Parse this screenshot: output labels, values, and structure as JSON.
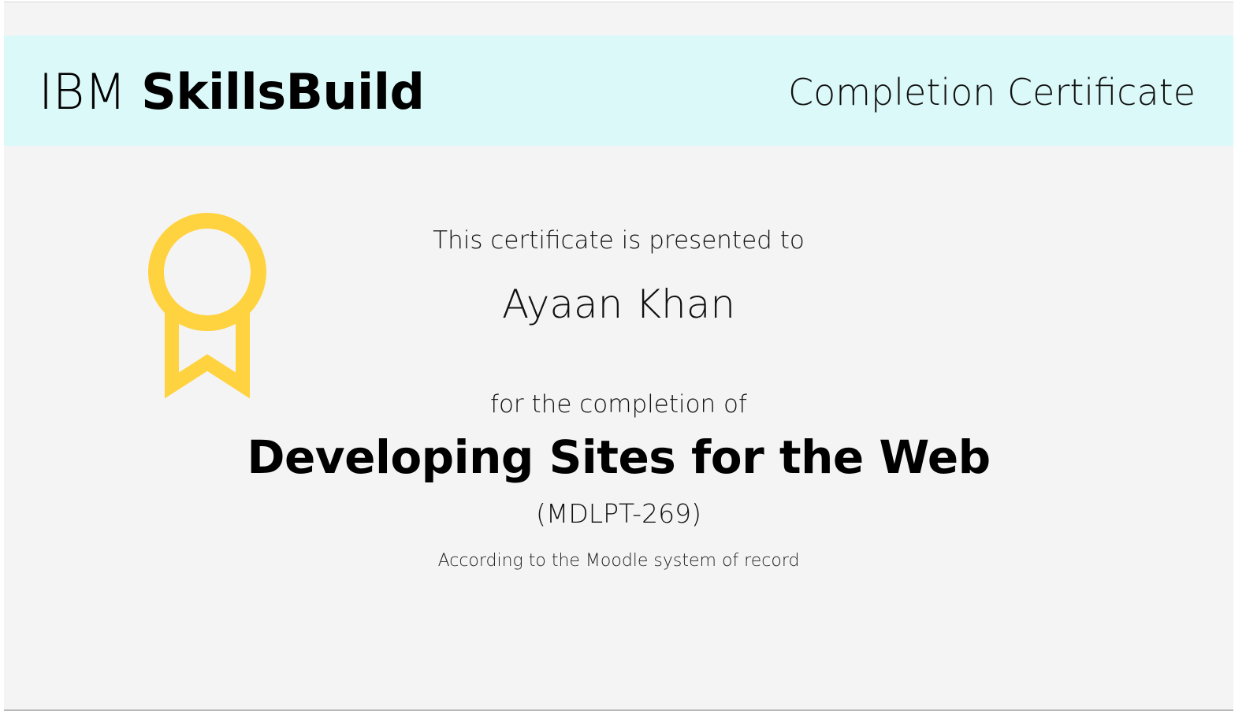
{
  "header": {
    "brand_prefix": "IBM",
    "brand_name": "SkillsBuild",
    "title": "Completion Certificate",
    "background_color": "#dcf9f9"
  },
  "badge": {
    "icon": "award-ribbon-icon",
    "color": "#ffd23f"
  },
  "certificate": {
    "presented_text": "This certificate is presented to",
    "recipient_name": "Ayaan Khan",
    "completion_text": "for the completion of",
    "course_title": "Developing Sites for the Web",
    "course_code": "(MDLPT-269)",
    "record_note": "According to the Moodle system of record"
  }
}
